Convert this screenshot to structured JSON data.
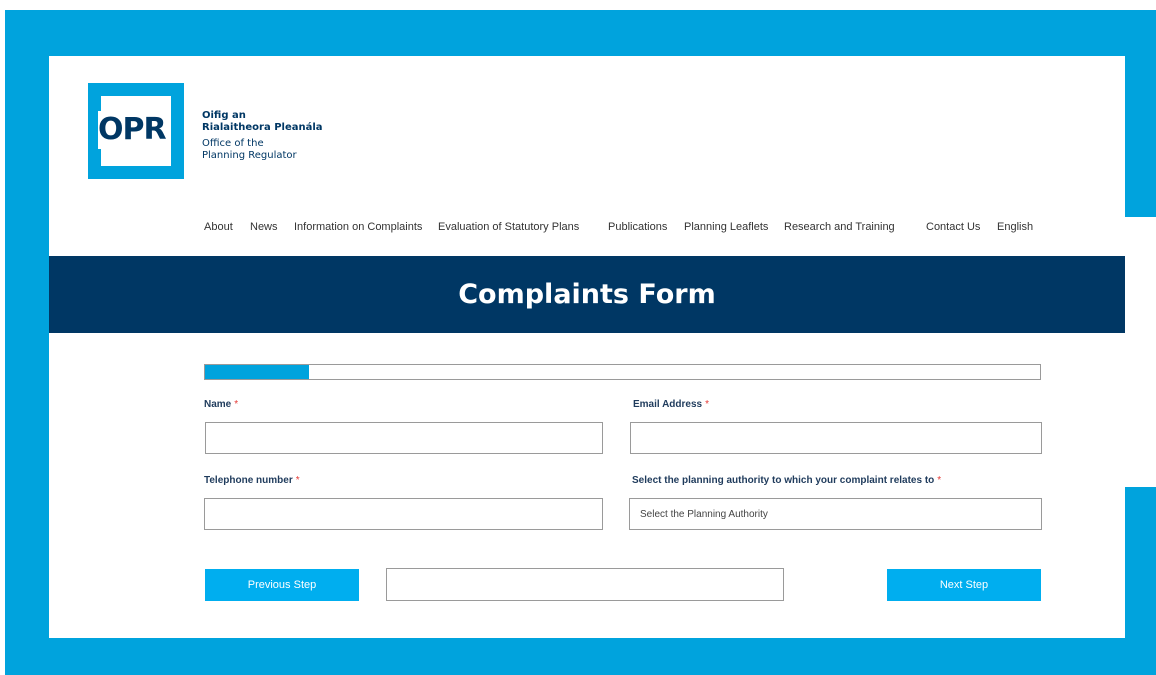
{
  "logo": {
    "text": "OPR",
    "irish_name_line1": "Oifig an",
    "irish_name_line2": "Rialaitheora Pleanála",
    "english_name_line1": "Office of the",
    "english_name_line2": "Planning Regulator"
  },
  "nav": {
    "items": [
      "About",
      "News",
      "Information on Complaints",
      "Evaluation of Statutory Plans",
      "Publications",
      "Planning Leaflets",
      "Research and Training",
      "Contact Us",
      "English"
    ]
  },
  "banner": {
    "title": "Complaints Form"
  },
  "progress": {
    "fraction": 0.124
  },
  "form": {
    "name_label": "Name",
    "email_label": "Email Address",
    "phone_label": "Telephone number",
    "authority_label": "Select the planning authority to which your complaint relates to",
    "required_mark": "*",
    "authority_placeholder": "Select the Planning Authority"
  },
  "buttons": {
    "previous": "Previous Step",
    "next": "Next Step"
  },
  "colors": {
    "accent": "#00a3dd",
    "navy": "#003764",
    "required": "#e53935"
  }
}
